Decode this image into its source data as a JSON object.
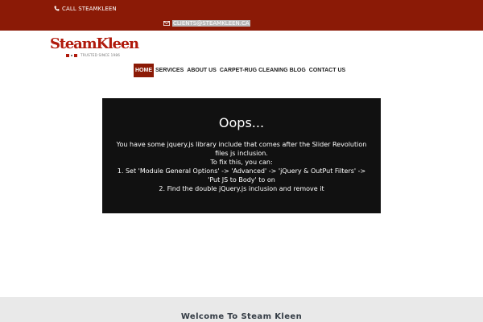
{
  "topbar": {
    "call_label": "CALL STEAMKLEEN",
    "email_label": "CLIENTS@STEAMKLEEN.CA",
    "background": "#8b1a06",
    "icons": [
      "phone-icon",
      "mail-icon"
    ]
  },
  "logo": {
    "wordmark": "SteamKleen",
    "tagline": "TRUSTED SINCE 1986",
    "color": "#b01a0c"
  },
  "nav": {
    "items": [
      {
        "label": "HOME",
        "active": true
      },
      {
        "label": "SERVICES",
        "active": false
      },
      {
        "label": "ABOUT US",
        "active": false
      },
      {
        "label": "CARPET-RUG CLEANING BLOG",
        "active": false
      },
      {
        "label": "CONTACT US",
        "active": false
      }
    ],
    "active_color": "#8b1a06"
  },
  "error_box": {
    "title": "Oops...",
    "lines": [
      "You have some jquery.js library include that comes after the Slider Revolution files js inclusion.",
      "To fix this, you can:",
      "1. Set 'Module General Options' -> 'Advanced' -> 'jQuery & OutPut Filters' -> 'Put JS to Body' to on",
      "2. Find the double jQuery.js inclusion and remove it"
    ],
    "background": "#111111"
  },
  "footer": {
    "heading": "Welcome To Steam Kleen"
  }
}
